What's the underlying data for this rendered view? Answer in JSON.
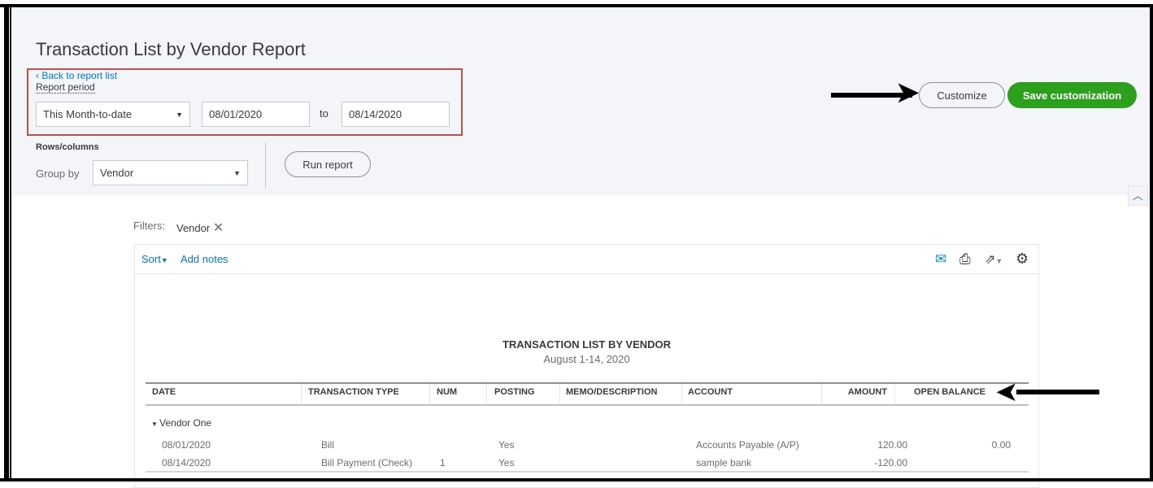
{
  "header": {
    "title": "Transaction List by Vendor Report",
    "back_link": "Back to report list",
    "report_period_label": "Report period",
    "period_select": "This Month-to-date",
    "start_date": "08/01/2020",
    "to_label": "to",
    "end_date": "08/14/2020",
    "rows_columns_label": "Rows/columns",
    "group_by_label": "Group by",
    "group_by_value": "Vendor",
    "run_report": "Run report",
    "customize": "Customize",
    "save_customization": "Save customization"
  },
  "filters": {
    "label": "Filters:",
    "chip": "Vendor"
  },
  "toolbar": {
    "sort": "Sort",
    "add_notes": "Add notes"
  },
  "report": {
    "title": "TRANSACTION LIST BY VENDOR",
    "subtitle": "August 1-14, 2020",
    "columns": [
      "DATE",
      "TRANSACTION TYPE",
      "NUM",
      "POSTING",
      "MEMO/DESCRIPTION",
      "ACCOUNT",
      "AMOUNT",
      "OPEN BALANCE"
    ],
    "group": "Vendor One",
    "rows": [
      {
        "date": "08/01/2020",
        "type": "Bill",
        "num": "",
        "posting": "Yes",
        "memo": "",
        "account": "Accounts Payable (A/P)",
        "amount": "120.00",
        "open_balance": "0.00"
      },
      {
        "date": "08/14/2020",
        "type": "Bill Payment (Check)",
        "num": "1",
        "posting": "Yes",
        "memo": "",
        "account": "sample bank",
        "amount": "-120.00",
        "open_balance": ""
      }
    ]
  },
  "colors": {
    "accent": "#0077c5",
    "green": "#2ca01c",
    "highlight": "#c0504d"
  }
}
